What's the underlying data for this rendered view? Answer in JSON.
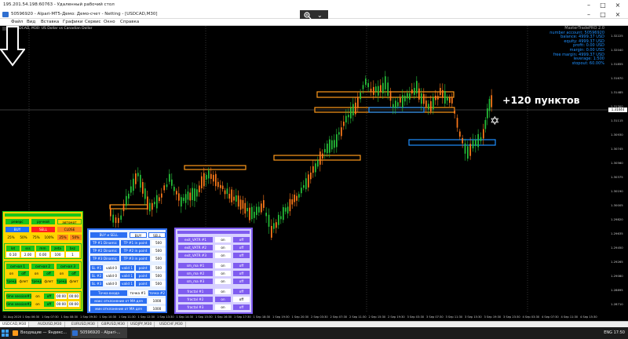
{
  "rdp": {
    "title": "195.201.54.198:60763 - Удаленный рабочий стол",
    "minimize": "–",
    "maximize": "□",
    "close": "×",
    "zoom_icon": "zoom-in-icon",
    "zoom_chevron": "⌄"
  },
  "app": {
    "title": "50596920 - Alpari-MT5-Демо: Демо-счет - Netting - [USDCAD,M30]",
    "minimize": "–",
    "maximize": "□",
    "close": "×"
  },
  "menu": [
    "Файл",
    "Вид",
    "Вставка",
    "Графики",
    "Сервис",
    "Окно",
    "Справка"
  ],
  "chart": {
    "symbol_label": "USDCAD, M30: US Dollar vs Canadian Dollar",
    "account": {
      "title": "MasterTradePRO 2.0",
      "lines": [
        "number account: 50596920",
        "balance: 4999.37 USD",
        "equity: 4999.37 USD",
        "profit: 0.00 USD",
        "margin: 0.00 USD",
        "free margin: 4999.37 USD",
        "leverage: 1:500",
        "stopout: 60.00%"
      ]
    },
    "annotation": "+120 пунктов",
    "star_glyph": "✡",
    "current_price": "1.31444",
    "price_labels": [
      "1.32225",
      "1.32040",
      "1.31855",
      "1.31670",
      "1.31485",
      "1.31300",
      "1.31115",
      "1.30930",
      "1.30745",
      "1.30560",
      "1.30375",
      "1.30190",
      "1.30005",
      "1.29820",
      "1.29635",
      "1.29450",
      "1.29265",
      "1.29080",
      "1.28895",
      "1.28710"
    ],
    "time_labels": [
      "31 Aug 2020",
      "1 Sep 06:30",
      "1 Sep 07:30",
      "1 Sep 08:30",
      "1 Sep 09:30",
      "1 Sep 10:30",
      "1 Sep 11:30",
      "1 Sep 12:30",
      "1 Sep 13:30",
      "1 Sep 14:30",
      "1 Sep 15:30",
      "1 Sep 16:30",
      "1 Sep 17:30",
      "1 Sep 18:30",
      "1 Sep 19:30",
      "1 Sep 20:30",
      "2 Sep 03:30",
      "2 Sep 07:30",
      "2 Sep 11:30",
      "2 Sep 15:30",
      "2 Sep 19:30",
      "3 Sep 03:30",
      "3 Sep 07:30",
      "3 Sep 11:30",
      "3 Sep 15:30",
      "3 Sep 19:30",
      "3 Sep 23:30",
      "4 Sep 03:30",
      "4 Sep 07:30",
      "4 Sep 11:30",
      "4 Sep 15:30"
    ]
  },
  "panel_left": {
    "r1": [
      "реверс",
      "ручной",
      "автомат"
    ],
    "r2": [
      "BUY",
      "SELL",
      "CLOSE"
    ],
    "r3": [
      "25%",
      "50%",
      "75%",
      "100%",
      "25%",
      "50%"
    ],
    "r4h": [
      "lot",
      "sss",
      "mm",
      "zeta",
      "bsz"
    ],
    "r4v": [
      "0.10",
      "2.00",
      "0.00",
      "100",
      "1"
    ],
    "r5": [
      "сигнал 1",
      "сигнал 2",
      "сигнал 3"
    ],
    "r6": [
      "on",
      "off",
      "on",
      "off",
      "on",
      "off"
    ],
    "r7": [
      "тренд",
      "флет",
      "тренд",
      "флет",
      "тренд",
      "флет"
    ],
    "r8": [
      "time session#1",
      "on",
      "off",
      "00:00",
      "00:00"
    ],
    "r9": [
      "time session#2",
      "on",
      "off",
      "00:00",
      "00:00"
    ]
  },
  "panel_mid": {
    "r1": [
      "BUY и SELL",
      "BUY",
      "SELL"
    ],
    "r2": [
      "TP #1 Dinamic",
      "TP #1 in point",
      "500"
    ],
    "r3": [
      "TP #2 Dinamic",
      "TP #2 in point",
      "500"
    ],
    "r4": [
      "TP #3 Dinamic",
      "TP #3 in point",
      "500"
    ],
    "r5": [
      "SL #1",
      "valid 0",
      "valid 1",
      "point",
      "500"
    ],
    "r6": [
      "SL #2",
      "valid 0",
      "valid 1",
      "point",
      "500"
    ],
    "r7": [
      "SL #3",
      "valid 0",
      "valid 1",
      "point",
      "500"
    ],
    "r8": [
      "Точка входа",
      "точка #1",
      "точка #2"
    ],
    "r9": [
      "макс отклонение от МА для",
      "1000"
    ],
    "r10": [
      "мин отклонение от МА для",
      "1000"
    ]
  },
  "panel_right": {
    "rows": [
      {
        "label": "exit_VATR #1",
        "on": "on",
        "off": "off"
      },
      {
        "label": "exit_VATR #2",
        "on": "on",
        "off": "off"
      },
      {
        "label": "exit_VATR #3",
        "on": "on",
        "off": "off"
      },
      {
        "label": "sm_ma #1",
        "on": "on",
        "off": "off"
      },
      {
        "label": "sm_ma #2",
        "on": "on",
        "off": "off"
      },
      {
        "label": "sm_ma #3",
        "on": "on",
        "off": "off"
      },
      {
        "label": "fractal #1",
        "on": "on",
        "off": "off"
      },
      {
        "label": "fractal #2",
        "on": "on",
        "off": "off"
      },
      {
        "label": "fractal #3",
        "on": "on",
        "off": "off"
      }
    ]
  },
  "tabs": [
    "USDCAD,M30",
    "AUDUSD,M30",
    "EURUSD,M30",
    "GBPUSD,M30",
    "USDJPY,M30",
    "USDCHF,M30"
  ],
  "taskbar": {
    "items": [
      "Входящие — Яндекс...",
      "50596920 - Alpari-..."
    ],
    "tray": "ENG   17:50"
  },
  "colors": {
    "bull": "#26c23a",
    "bear": "#ff7a1a",
    "orange_zone": "#ff9a1a",
    "blue_zone": "#1e90ff"
  }
}
